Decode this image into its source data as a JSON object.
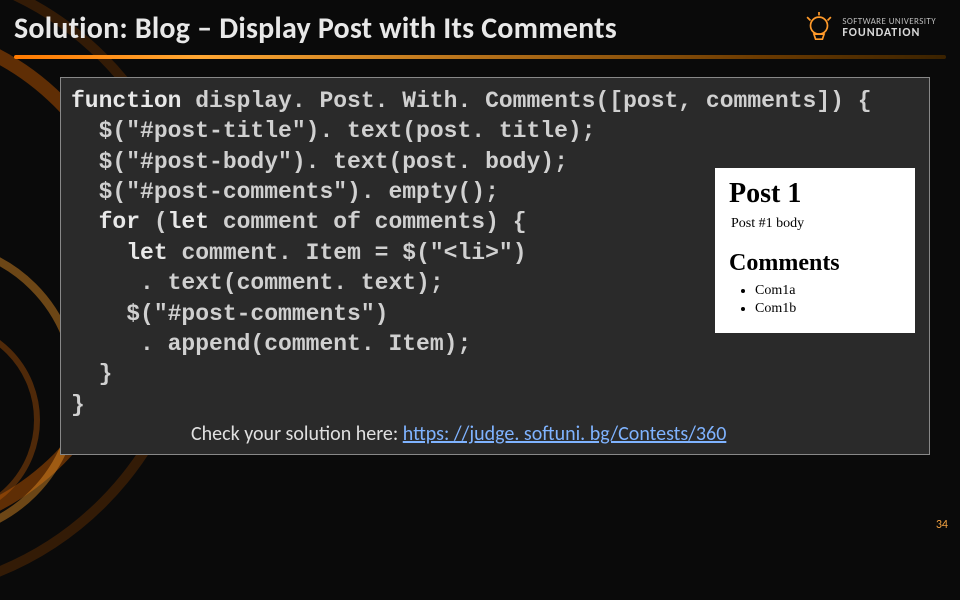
{
  "header": {
    "title": "Solution: Blog – Display Post with Its Comments",
    "logo": {
      "line1": "SOFTWARE UNIVERSITY",
      "line2": "FOUNDATION"
    }
  },
  "code": {
    "l1_kw": "function",
    "l1_rest": " display. Post. With. Comments([post, comments]) {",
    "l2": "  $(\"#post-title\"). text(post. title);",
    "l3": "  $(\"#post-body\"). text(post. body);",
    "l4": "  $(\"#post-comments\"). empty();",
    "l5_kw": "  for",
    "l5_mid": " (",
    "l5_let": "let",
    "l5_rest": " comment of comments) {",
    "l6_pre": "    ",
    "l6_let": "let",
    "l6_rest": " comment. Item = $(\"<li>\")",
    "l7": "     . text(comment. text);",
    "l8": "    $(\"#post-comments\")",
    "l9": "     . append(comment. Item);",
    "l10": "  }",
    "l11": "}"
  },
  "preview": {
    "title": "Post 1",
    "body": "Post #1 body",
    "comments_heading": "Comments",
    "comments": [
      "Com1a",
      "Com1b"
    ]
  },
  "check": {
    "label": "Check your solution here: ",
    "url_text": "https: //judge. softuni. bg/Contests/360"
  },
  "page_number": "34"
}
